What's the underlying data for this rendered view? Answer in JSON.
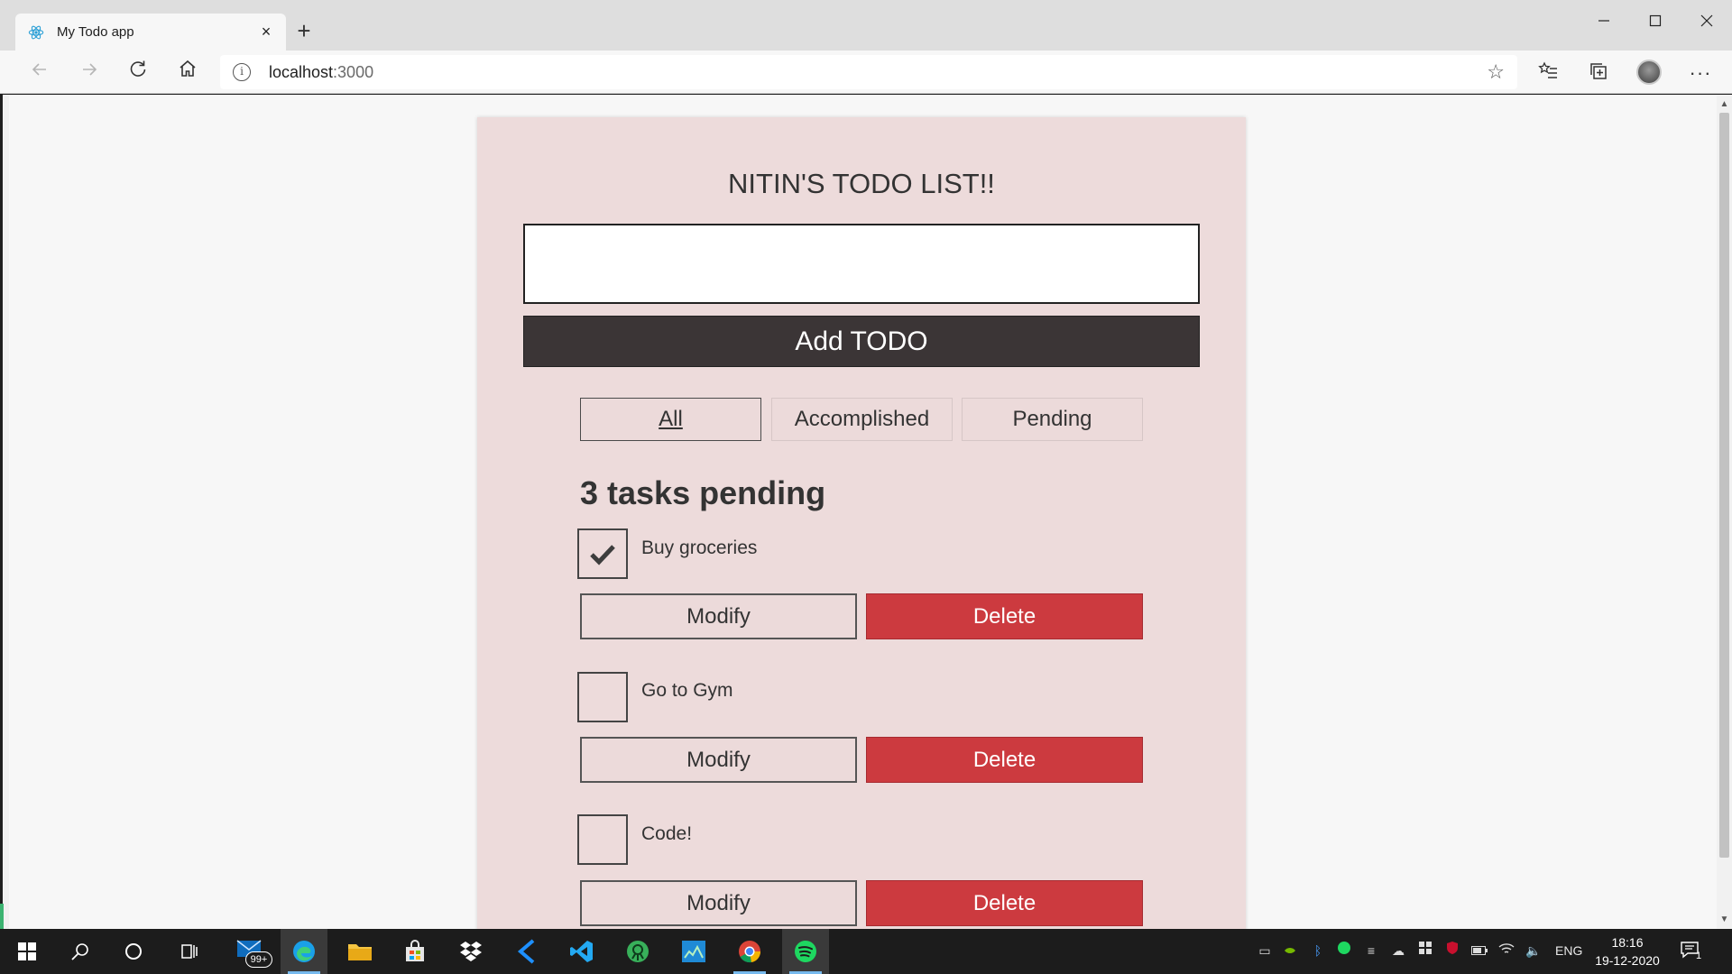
{
  "browser": {
    "tab_title": "My Todo app",
    "tab_close": "×",
    "new_tab": "+",
    "url_host": "localhost",
    "url_port": ":3000"
  },
  "app": {
    "title": "NITIN'S TODO LIST!!",
    "input_value": "",
    "input_placeholder": "",
    "add_button_label": "Add TODO",
    "filters": [
      {
        "label": "All",
        "active": true
      },
      {
        "label": "Accomplished",
        "active": false
      },
      {
        "label": "Pending",
        "active": false
      }
    ],
    "pending_count_text": "3 tasks pending",
    "todos": [
      {
        "text": "Buy groceries",
        "checked": true,
        "modify_label": "Modify",
        "delete_label": "Delete"
      },
      {
        "text": "Go to Gym",
        "checked": false,
        "modify_label": "Modify",
        "delete_label": "Delete"
      },
      {
        "text": "Code!",
        "checked": false,
        "modify_label": "Modify",
        "delete_label": "Delete"
      }
    ],
    "colors": {
      "card_bg": "#eddbdb",
      "add_button_bg": "#3b3536",
      "delete_button_bg": "#cc3a3f"
    }
  },
  "taskbar": {
    "mail_badge": "99+",
    "language": "ENG",
    "time": "18:16",
    "date": "19-12-2020",
    "notification_count": "1",
    "pinned_apps": [
      "mail-icon",
      "edge-icon",
      "file-explorer-icon",
      "store-icon",
      "dropbox-icon",
      "visual-studio-icon",
      "vscode-icon",
      "gitkraken-icon",
      "task-manager-icon",
      "chrome-icon",
      "spotify-icon"
    ]
  }
}
